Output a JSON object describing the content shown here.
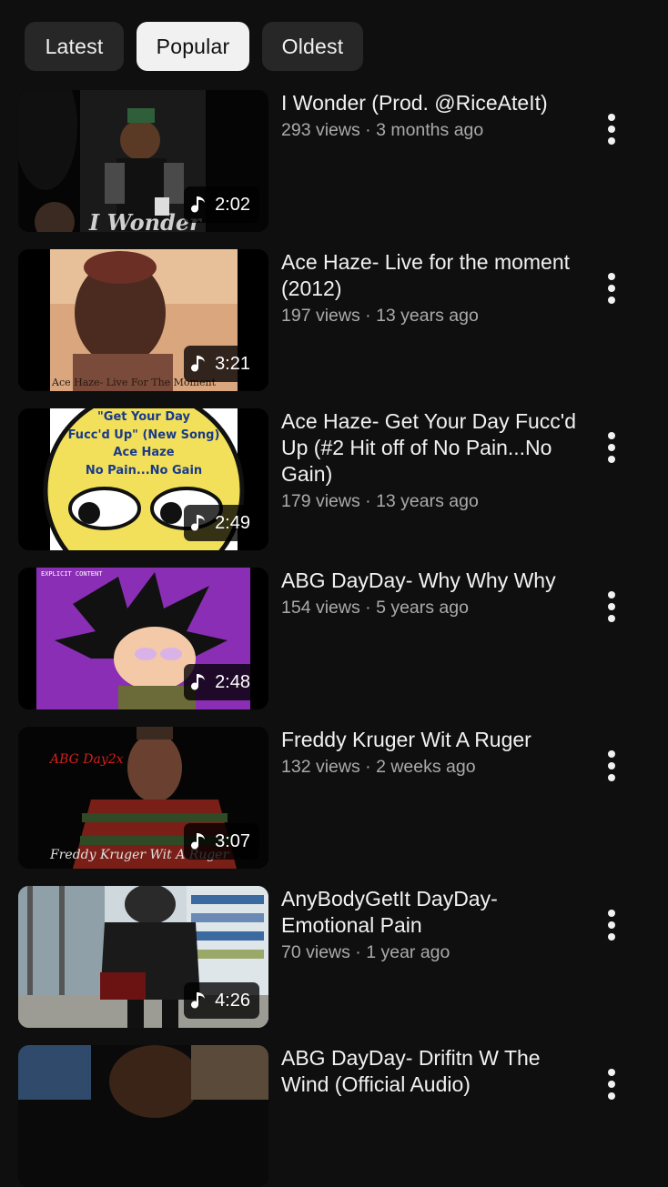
{
  "filters": {
    "latest": "Latest",
    "popular": "Popular",
    "oldest": "Oldest",
    "selected": "Popular"
  },
  "videos": [
    {
      "title": "I Wonder (Prod. @RiceAteIt)",
      "views": "293 views",
      "age": "3 months ago",
      "duration": "2:02",
      "thumb_text": "I Wonder"
    },
    {
      "title": "Ace Haze- Live for the moment (2012)",
      "views": "197 views",
      "age": "13 years ago",
      "duration": "3:21",
      "thumb_text": "Ace Haze- Live For The Moment"
    },
    {
      "title": "Ace Haze- Get Your Day Fucc'd Up (#2 Hit off of No Pain...No Gain)",
      "views": "179 views",
      "age": "13 years ago",
      "duration": "2:49",
      "thumb_text_lines": [
        "\"Get Your Day",
        "Fucc'd Up\" (New Song)",
        "Ace Haze",
        "No Pain...No Gain"
      ]
    },
    {
      "title": "ABG DayDay- Why Why Why",
      "views": "154 views",
      "age": "5 years ago",
      "duration": "2:48",
      "thumb_text": "EXPLICIT CONTENT"
    },
    {
      "title": "Freddy Kruger Wit A Ruger",
      "views": "132 views",
      "age": "2 weeks ago",
      "duration": "3:07",
      "thumb_text_top": "ABG Day2x",
      "thumb_text_bottom": "Freddy Kruger Wit A Ruger"
    },
    {
      "title": "AnyBodyGetIt DayDay- Emotional Pain",
      "views": "70 views",
      "age": "1 year ago",
      "duration": "4:26"
    },
    {
      "title": "ABG DayDay- Drifitn W The Wind (Official Audio)",
      "views": "",
      "age": "",
      "duration": ""
    }
  ],
  "meta_separator": " · ",
  "colors": {
    "background": "#0f0f0f",
    "chip": "#272727",
    "chip_active": "#f1f1f1",
    "meta_text": "#aaaaaa"
  },
  "icons": {
    "duration": "music-note-icon",
    "menu": "more-vert-icon"
  }
}
